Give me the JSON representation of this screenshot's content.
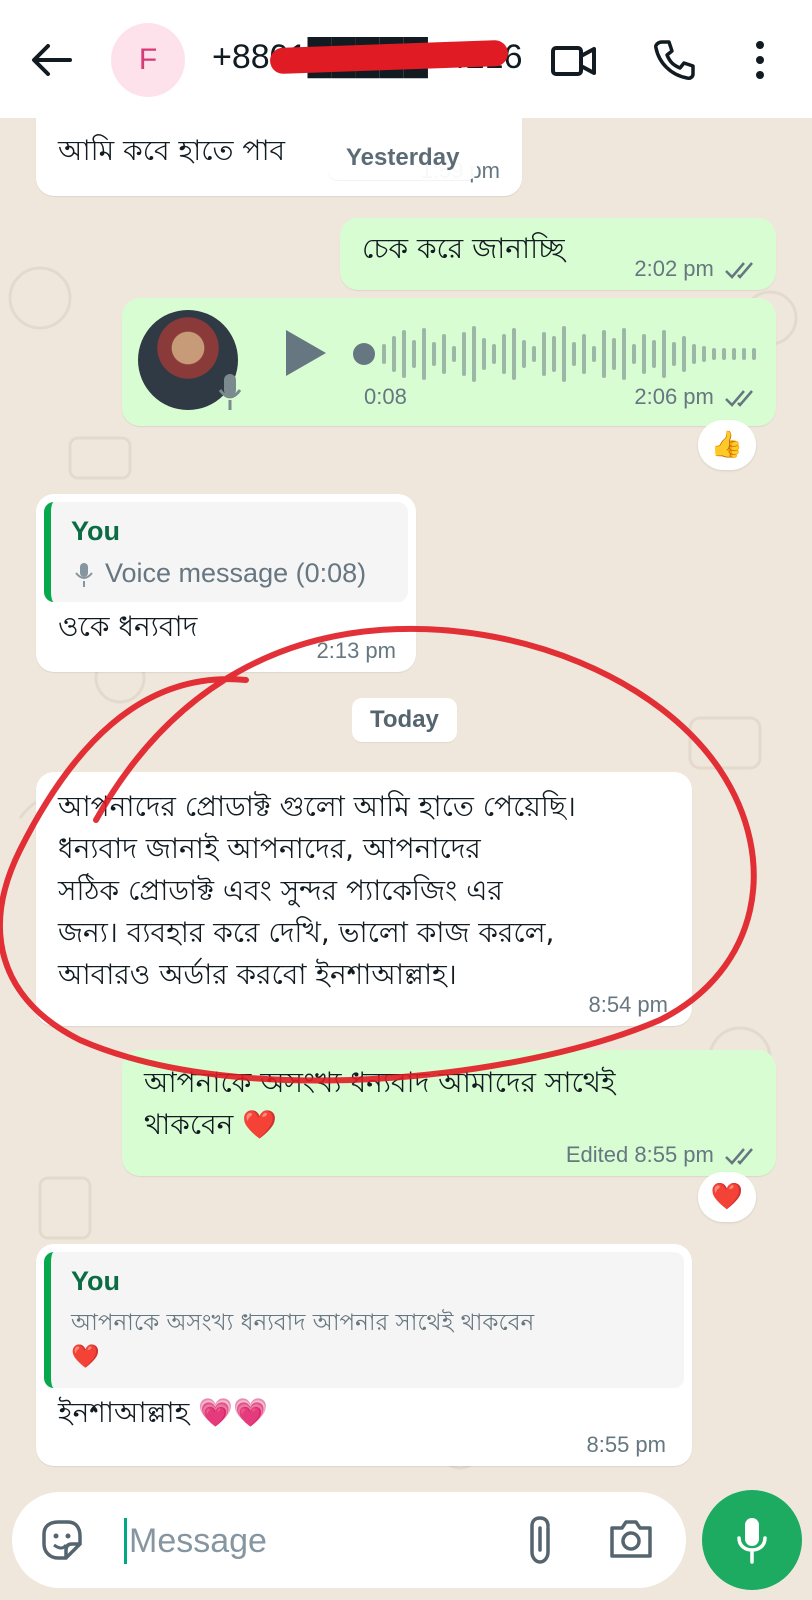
{
  "header": {
    "avatar_initial": "F",
    "contact_number": "+8801█████74216"
  },
  "messages": {
    "m1": {
      "text": "আমি কবে হাতে পাব",
      "time": "1:59 pm",
      "overlay_chip": "Yesterday"
    },
    "m2": {
      "text": "চেক করে জানাচ্ছি",
      "time": "2:02 pm"
    },
    "voice": {
      "duration": "0:08",
      "time": "2:06 pm",
      "reaction": "👍"
    },
    "m3": {
      "quote_author": "You",
      "quote_text": "Voice message (0:08)",
      "text": "ওকে ধন্যবাদ",
      "time": "2:13 pm"
    },
    "date_today": "Today",
    "m4": {
      "lines": [
        "আপনাদের প্রোডাক্ট গুলো আমি হাতে পেয়েছি।",
        "ধন্যবাদ জানাই আপনাদের, আপনাদের",
        "সঠিক প্রোডাক্ট এবং সুন্দর প্যাকেজিং এর",
        "জন্য।  ব্যবহার করে দেখি, ভালো কাজ করলে,",
        "আবারও অর্ডার করবো ইনশাআল্লাহ।"
      ],
      "time": "8:54 pm"
    },
    "m5": {
      "lines": [
        "আপনাকে অসংখ্য ধন্যবাদ আমাদের  সাথেই",
        "থাকবেন ❤️"
      ],
      "edited_label": "Edited",
      "time": "8:55 pm",
      "reaction": "❤️"
    },
    "m6": {
      "quote_author": "You",
      "quote_line1": "আপনাকে অসংখ্য ধন্যবাদ আপনার সাথেই থাকবেন",
      "quote_line2": "❤️",
      "text": "ইনশাআল্লাহ 💗💗",
      "time": "8:55 pm"
    }
  },
  "composer": {
    "placeholder": "Message"
  },
  "colors": {
    "outgoing_bubble": "#d9fdd3",
    "incoming_bubble": "#ffffff",
    "accent_green": "#1daa61",
    "chat_bg": "#efe7dc",
    "annotation_red": "#e01b24"
  },
  "icons": [
    "back-arrow-icon",
    "video-call-icon",
    "phone-icon",
    "more-options-icon",
    "play-icon",
    "mic-icon",
    "sticker-icon",
    "attach-icon",
    "camera-icon",
    "double-tick-icon"
  ]
}
